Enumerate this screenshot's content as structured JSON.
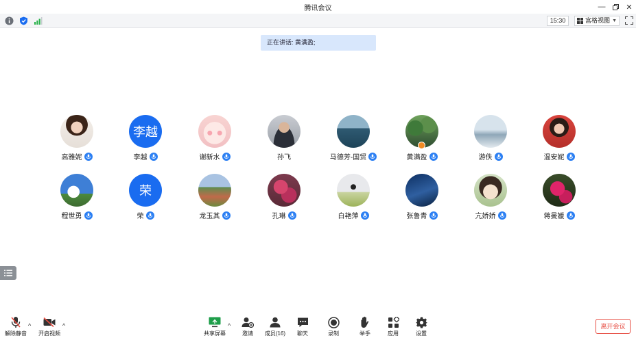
{
  "window": {
    "title": "腾讯会议"
  },
  "status_bar": {
    "time": "15:30",
    "view_mode": "宫格视图",
    "icons": [
      "info-icon",
      "shield-icon",
      "signal-icon"
    ]
  },
  "speaking": {
    "text": "正在讲话: 黄满盈;"
  },
  "colors": {
    "accent": "#1a6cf0",
    "mic": "#2b7ff3",
    "banner": "#d8e7fc",
    "leave": "#e64a3f"
  },
  "participants": [
    {
      "name": "高雅妮",
      "avatar_type": "photo"
    },
    {
      "name": "李越",
      "avatar_type": "text",
      "avatar_text": "李越"
    },
    {
      "name": "谢新水",
      "avatar_type": "photo"
    },
    {
      "name": "孙飞",
      "avatar_type": "photo",
      "mic": false
    },
    {
      "name": "马德芳-国贸",
      "avatar_type": "photo"
    },
    {
      "name": "黄满盈",
      "avatar_type": "photo",
      "host": true
    },
    {
      "name": "游佚",
      "avatar_type": "photo"
    },
    {
      "name": "温安妮",
      "avatar_type": "photo"
    },
    {
      "name": "程世勇",
      "avatar_type": "photo"
    },
    {
      "name": "荣",
      "avatar_type": "text",
      "avatar_text": "荣"
    },
    {
      "name": "龙玉其",
      "avatar_type": "photo"
    },
    {
      "name": "孔琳",
      "avatar_type": "photo"
    },
    {
      "name": "白艳萍",
      "avatar_type": "photo"
    },
    {
      "name": "张鲁青",
      "avatar_type": "photo"
    },
    {
      "name": "亢娇娇",
      "avatar_type": "photo"
    },
    {
      "name": "蒋曼媛",
      "avatar_type": "photo"
    }
  ],
  "toolbar": {
    "unmute": "解除静音",
    "start_video": "开启视频",
    "share_screen": "共享屏幕",
    "invite": "邀请",
    "members": "成员(16)",
    "chat": "聊天",
    "record": "录制",
    "raise_hand": "举手",
    "apps": "应用",
    "settings": "设置",
    "leave": "离开会议"
  }
}
